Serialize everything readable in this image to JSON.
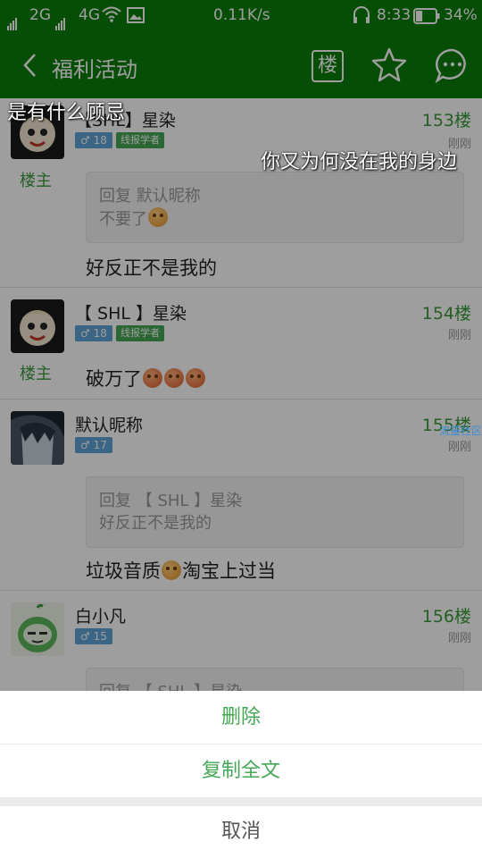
{
  "status_bar": {
    "network_2g": "2G",
    "network_4g": "4G",
    "speed": "0.11K/s",
    "time": "8:33",
    "battery": "34%",
    "battery_level": 0.34
  },
  "app_bar": {
    "title": "福利活动",
    "floor_button": "楼"
  },
  "posts": [
    {
      "name": "【SHL】星染",
      "gender_age": "♂ 18",
      "rank": "线报学者",
      "floor": "153楼",
      "time": "刚刚",
      "is_op": true,
      "op_label": "楼主",
      "quote_line1": "回复 默认昵称",
      "quote_line2": "不要了",
      "content": "好反正不是我的"
    },
    {
      "name": "【 SHL 】星染",
      "gender_age": "♂ 18",
      "rank": "线报学者",
      "floor": "154楼",
      "time": "刚刚",
      "is_op": true,
      "op_label": "楼主",
      "content": "破万了"
    },
    {
      "name": "默认昵称",
      "gender_age": "♂ 17",
      "floor": "155楼",
      "time": "刚刚",
      "quote_line1": "回复 【 SHL 】星染",
      "quote_line2": "好反正不是我的",
      "content_part1": "垃圾音质",
      "content_part2": "淘宝上过当"
    },
    {
      "name": "白小凡",
      "gender_age": "♂ 15",
      "floor": "156楼",
      "time": "刚刚",
      "quote_line1": "回复 【 SHL 】星染"
    }
  ],
  "danmaku": {
    "line1": "是有什么顾忌",
    "line2": "你又为何没在我的身边",
    "side_tag": "流量社区"
  },
  "action_sheet": {
    "delete": "删除",
    "copy_all": "复制全文",
    "cancel": "取消"
  },
  "colors": {
    "brand_green": "#0a7d0a",
    "accent_green": "#45a656",
    "gender_blue": "#5ea3d6"
  }
}
